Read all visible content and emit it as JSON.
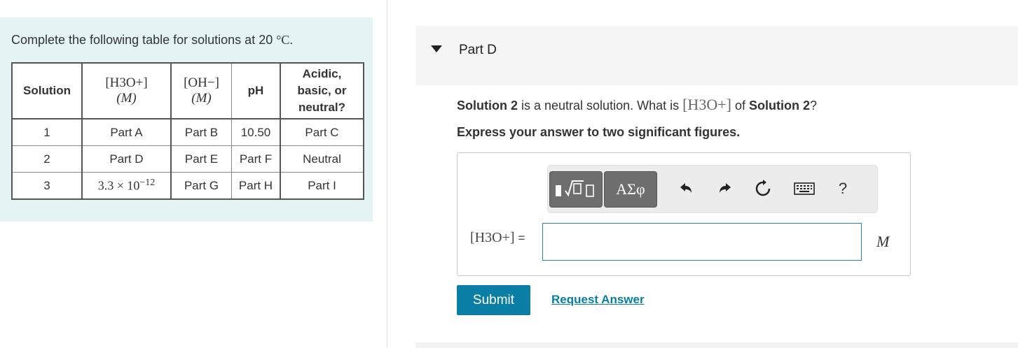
{
  "intro": {
    "text": "Complete the following table for solutions at 20 ",
    "temp_unit": "°C."
  },
  "table": {
    "headers": {
      "solution": "Solution",
      "h3o_top": "[H3O+]",
      "h3o_unit": "(M)",
      "oh_top": "[OH−]",
      "oh_unit": "(M)",
      "ph": "pH",
      "acidic": "Acidic, basic, or neutral?"
    },
    "rows": [
      {
        "solution": "1",
        "h3o": "Part A",
        "oh": "Part B",
        "ph": "10.50",
        "nature": "Part C"
      },
      {
        "solution": "2",
        "h3o": "Part D",
        "oh": "Part E",
        "ph": "Part F",
        "nature": "Neutral"
      },
      {
        "solution": "3",
        "h3o": "3.3 × 10",
        "h3o_exp": "−12",
        "oh": "Part G",
        "ph": "Part H",
        "nature": "Part I"
      }
    ]
  },
  "part": {
    "title": "Part D",
    "question_prefix": "Solution 2",
    "question_mid": " is a neutral solution. What is ",
    "question_species": "[H3O+]",
    "question_of": " of ",
    "question_target": "Solution 2",
    "question_end": "?",
    "instruction": "Express your answer to two significant figures."
  },
  "toolbar": {
    "greek_label": "ΑΣφ",
    "icons": [
      "templates-icon",
      "greek-symbols-icon",
      "undo-icon",
      "redo-icon",
      "reset-icon",
      "keyboard-icon",
      "help-icon"
    ],
    "help_label": "?"
  },
  "answer": {
    "label": "[H3O+]",
    "equals": "=",
    "value": "",
    "unit": "M"
  },
  "buttons": {
    "submit": "Submit",
    "request_answer": "Request Answer"
  },
  "colors": {
    "panel_bg": "#e4f4f5",
    "accent": "#0a7ea4"
  }
}
